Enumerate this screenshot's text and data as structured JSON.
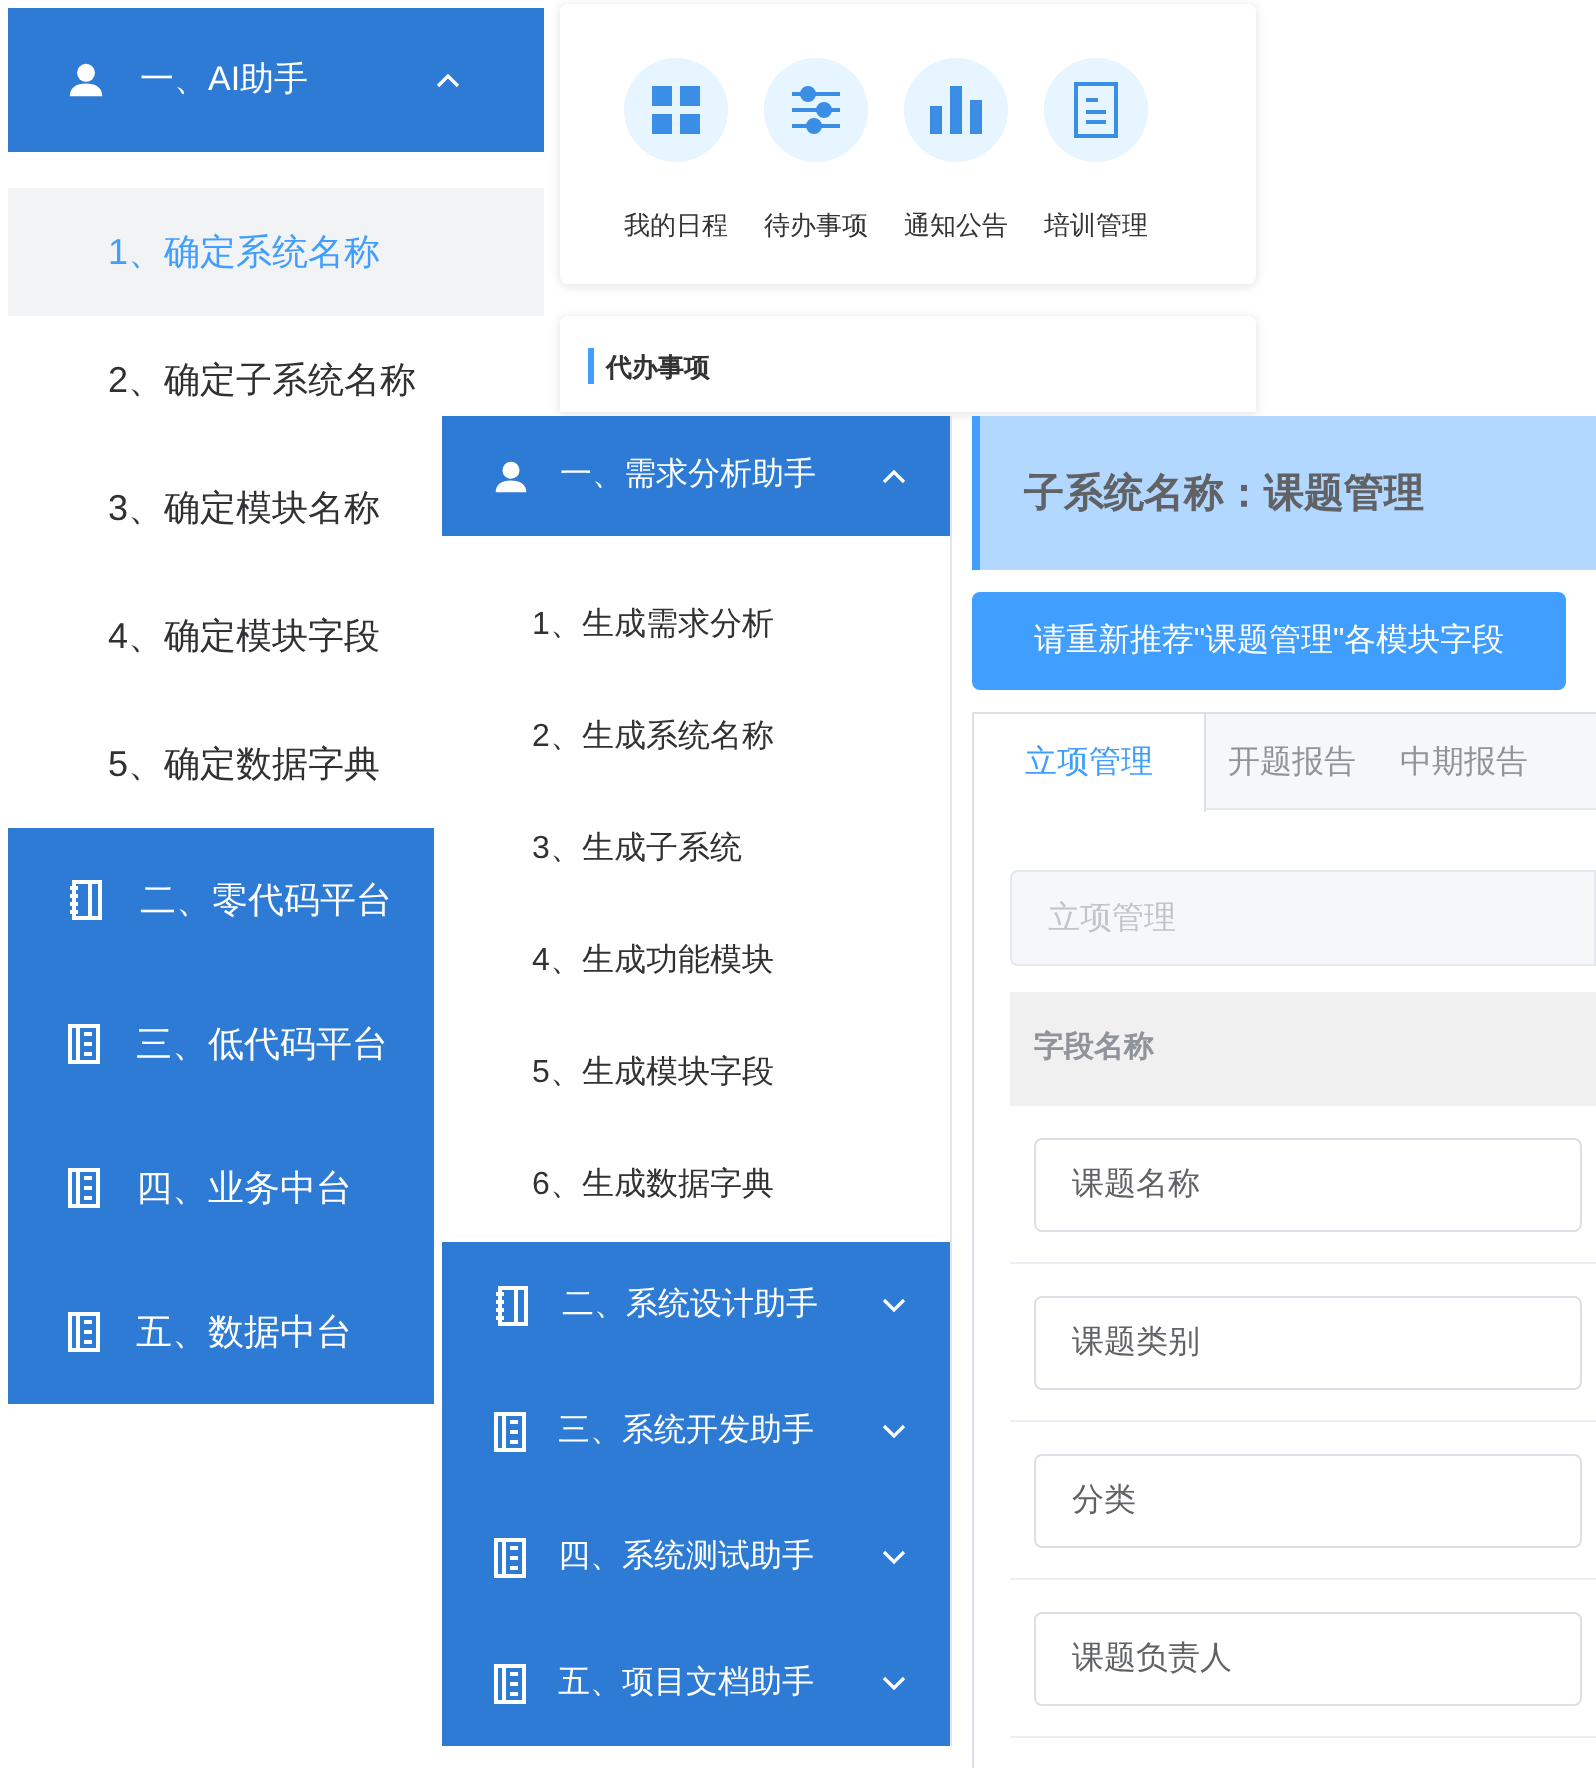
{
  "menu_left": {
    "header": {
      "label": "一、AI助手",
      "expanded": true
    },
    "items": [
      {
        "label": "1、确定系统名称",
        "selected": true
      },
      {
        "label": "2、确定子系统名称",
        "selected": false
      },
      {
        "label": "3、确定模块名称",
        "selected": false
      },
      {
        "label": "4、确定模块字段",
        "selected": false
      },
      {
        "label": "5、确定数据字典",
        "selected": false
      }
    ],
    "groups": [
      {
        "label": "二、零代码平台"
      },
      {
        "label": "三、低代码平台"
      },
      {
        "label": "四、业务中台"
      },
      {
        "label": "五、数据中台"
      }
    ]
  },
  "dashboard": {
    "shortcuts": [
      {
        "label": "我的日程"
      },
      {
        "label": "待办事项"
      },
      {
        "label": "通知公告"
      },
      {
        "label": "培训管理"
      }
    ],
    "todo_title": "代办事项"
  },
  "menu_assistant": {
    "header": {
      "label": "一、需求分析助手",
      "expanded": true
    },
    "items": [
      {
        "label": "1、生成需求分析",
        "selected": false
      },
      {
        "label": "2、生成系统名称",
        "selected": false
      },
      {
        "label": "3、生成子系统",
        "selected": false
      },
      {
        "label": "4、生成功能模块",
        "selected": false
      },
      {
        "label": "5、生成模块字段",
        "selected": false
      },
      {
        "label": "6、生成数据字典",
        "selected": false
      }
    ],
    "groups": [
      {
        "label": "二、系统设计助手",
        "expanded": false
      },
      {
        "label": "三、系统开发助手",
        "expanded": false
      },
      {
        "label": "四、系统测试助手",
        "expanded": false
      },
      {
        "label": "五、项目文档助手",
        "expanded": false
      }
    ]
  },
  "subsystem": {
    "title": "子系统名称：课题管理",
    "button": "请重新推荐\"课题管理\"各模块字段",
    "tabs": [
      {
        "label": "立项管理",
        "selected": true
      },
      {
        "label": "开题报告",
        "selected": false
      },
      {
        "label": "中期报告",
        "selected": false
      }
    ],
    "module_field": {
      "value": "立项管理",
      "disabled": true
    },
    "table": {
      "column": "字段名称",
      "rows": [
        {
          "value": "课题名称"
        },
        {
          "value": "课题类别"
        },
        {
          "value": "分类"
        },
        {
          "value": "课题负责人"
        }
      ]
    }
  }
}
